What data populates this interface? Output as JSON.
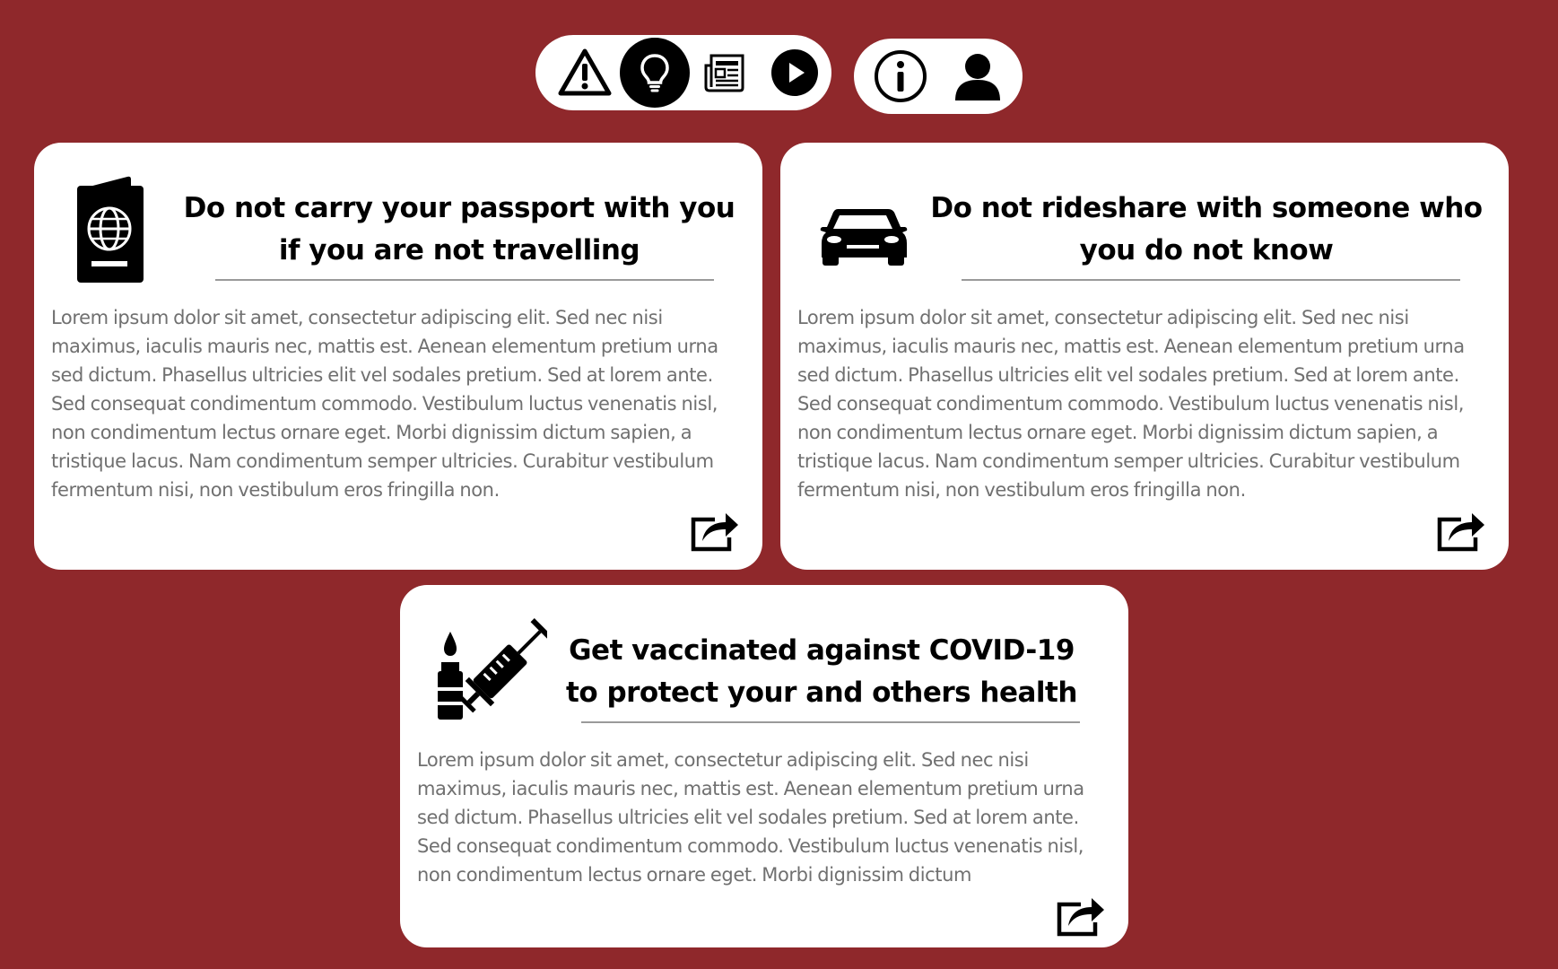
{
  "nav": {
    "items": [
      {
        "icon": "warning-icon",
        "active": false
      },
      {
        "icon": "lightbulb-icon",
        "active": true
      },
      {
        "icon": "newspaper-icon",
        "active": false
      },
      {
        "icon": "play-icon",
        "active": false
      }
    ],
    "secondary": [
      {
        "icon": "info-icon"
      },
      {
        "icon": "user-icon"
      }
    ]
  },
  "cards": [
    {
      "icon": "passport-icon",
      "title": "Do not carry your passport with you if you are not travelling",
      "body": "Lorem ipsum dolor sit amet, consectetur adipiscing elit. Sed nec nisi maximus, iaculis mauris nec, mattis est. Aenean elementum pretium urna sed dictum. Phasellus ultricies elit vel sodales pretium. Sed at lorem ante. Sed consequat condimentum commodo. Vestibulum luctus venenatis nisl, non condimentum lectus ornare eget. Morbi dignissim dictum sapien, a tristique lacus. Nam condimentum semper ultricies. Curabitur vestibulum fermentum nisi, non vestibulum eros fringilla non."
    },
    {
      "icon": "car-icon",
      "title": "Do not rideshare with someone who you do not know",
      "body": "Lorem ipsum dolor sit amet, consectetur adipiscing elit. Sed nec nisi maximus, iaculis mauris nec, mattis est. Aenean elementum pretium urna sed dictum. Phasellus ultricies elit vel sodales pretium. Sed at lorem ante. Sed consequat condimentum commodo. Vestibulum luctus venenatis nisl, non condimentum lectus ornare eget. Morbi dignissim dictum sapien, a tristique lacus. Nam condimentum semper ultricies. Curabitur vestibulum fermentum nisi, non vestibulum eros fringilla non."
    },
    {
      "icon": "vaccine-icon",
      "title": "Get vaccinated against COVID-19 to protect your and others health",
      "body": "Lorem ipsum dolor sit amet, consectetur adipiscing elit. Sed nec nisi maximus, iaculis mauris nec, mattis est. Aenean elementum pretium urna sed dictum. Phasellus ultricies elit vel sodales pretium. Sed at lorem ante. Sed consequat condimentum commodo. Vestibulum luctus venenatis nisl, non condimentum lectus ornare eget. Morbi dignissim dictum"
    }
  ],
  "colors": {
    "background": "#8f282b",
    "card": "#ffffff",
    "body_text": "#707070",
    "title_text": "#000000"
  }
}
